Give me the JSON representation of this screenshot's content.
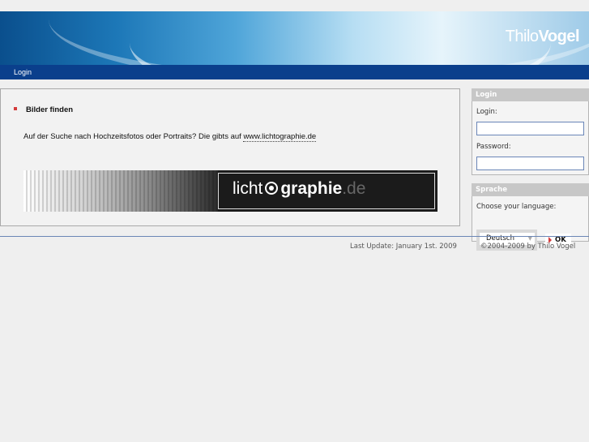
{
  "header": {
    "logo_light": "Thilo",
    "logo_bold": "Vogel"
  },
  "nav": {
    "login_label": "Login"
  },
  "main": {
    "heading": "Bilder finden",
    "text_before_link": "Auf der Suche nach Hochzeitsfotos oder Portraits? Die gibts auf ",
    "link_text": "www.lichtographie.de",
    "banner": {
      "word1": "licht",
      "word2": "graphie",
      "word3": ".de"
    }
  },
  "login_box": {
    "title": "Login",
    "login_label": "Login:",
    "login_value": "",
    "password_label": "Password:",
    "password_value": ""
  },
  "language_box": {
    "title": "Sprache",
    "prompt": "Choose your language:",
    "selected_language": "Deutsch",
    "ok_label": "OK"
  },
  "footer": {
    "last_update": "Last Update: January 1st. 2009",
    "copyright": "©2004-2009 by Thilo Vogel"
  },
  "colors": {
    "nav_bar": "#0a3f8c",
    "bullet": "#d43b3b",
    "box_title": "#c7c7c7",
    "rule": "#6b86b5"
  }
}
